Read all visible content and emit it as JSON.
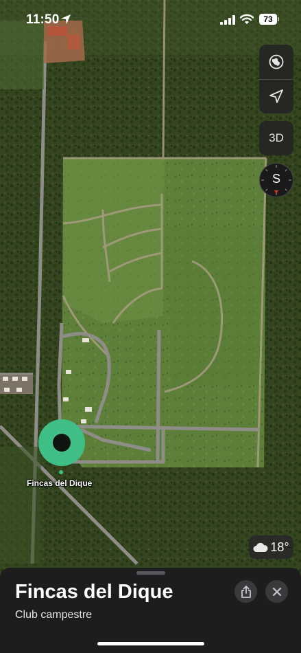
{
  "status_bar": {
    "time": "11:50",
    "battery": "73"
  },
  "map_controls": {
    "items": [
      {
        "name": "globe",
        "icon": "globe-icon"
      },
      {
        "name": "location",
        "icon": "location-arrow-icon"
      }
    ],
    "view_3d_label": "3D",
    "compass_heading": "S"
  },
  "map_pin": {
    "label": "Fincas del Dique",
    "color": "#3fbf86"
  },
  "weather": {
    "icon": "cloud-icon",
    "temperature": "18°"
  },
  "place_card": {
    "title": "Fincas del Dique",
    "subtitle": "Club campestre",
    "share_icon": "share-icon",
    "close_icon": "close-icon"
  },
  "colors": {
    "pin_accent": "#3fbf86",
    "sheet_bg": "#1d1d1f",
    "control_bg": "#232323"
  }
}
